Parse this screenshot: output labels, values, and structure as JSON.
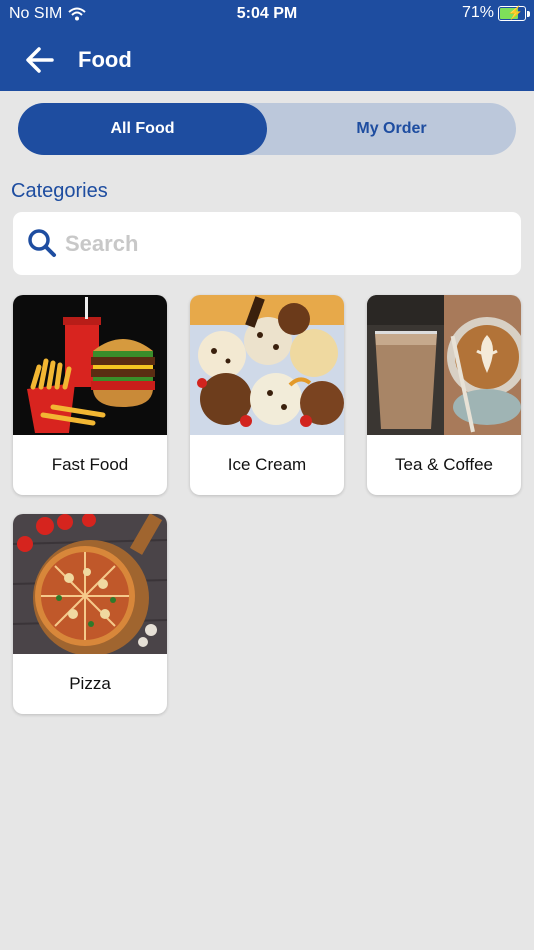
{
  "status_bar": {
    "carrier": "No SIM",
    "time": "5:04 PM",
    "battery": "71%"
  },
  "header": {
    "title": "Food",
    "back_icon": "arrow-left-icon"
  },
  "tabs": [
    {
      "label": "All Food",
      "active": true
    },
    {
      "label": "My Order",
      "active": false
    }
  ],
  "categories_heading": "Categories",
  "search": {
    "placeholder": "Search",
    "value": ""
  },
  "categories": [
    {
      "label": "Fast Food",
      "image": "fast-food-image"
    },
    {
      "label": "Ice Cream",
      "image": "ice-cream-image"
    },
    {
      "label": "Tea & Coffee",
      "image": "tea-coffee-image"
    },
    {
      "label": "Pizza",
      "image": "pizza-image"
    }
  ],
  "colors": {
    "brand": "#1e4da0",
    "segment_bg": "#bcc8db",
    "page_bg": "#e6e6e6"
  }
}
